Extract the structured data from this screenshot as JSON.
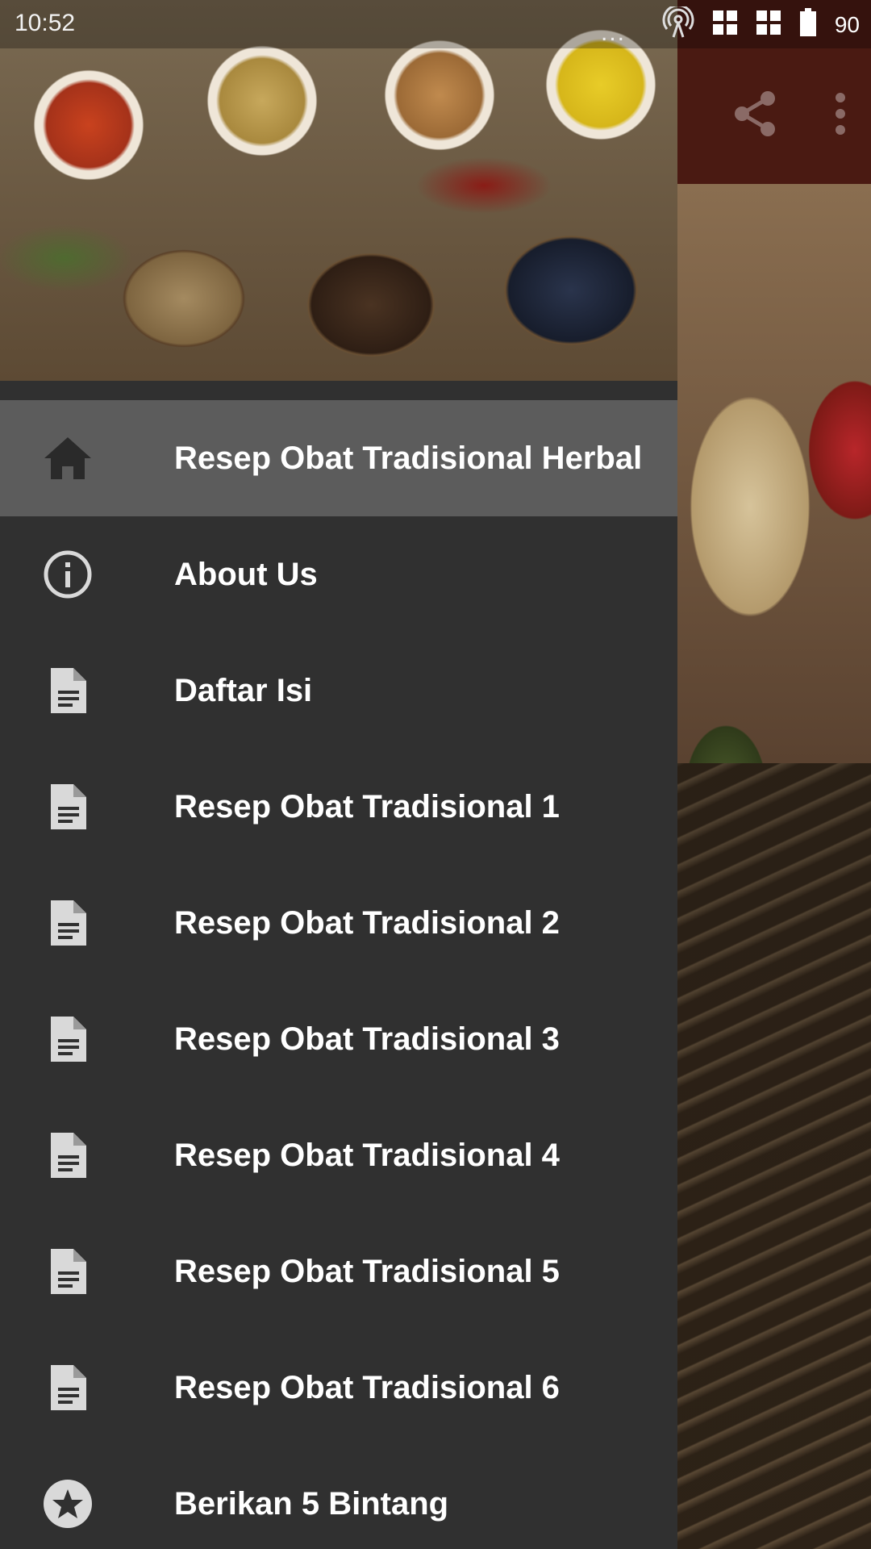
{
  "status_bar": {
    "time": "10:52",
    "overflow_dots": "...",
    "battery_level": "90"
  },
  "drawer": {
    "items": [
      {
        "label": "Resep Obat Tradisional Herbal",
        "icon": "home-icon",
        "active": true
      },
      {
        "label": "About Us",
        "icon": "info-icon",
        "active": false
      },
      {
        "label": "Daftar Isi",
        "icon": "document-icon",
        "active": false
      },
      {
        "label": "Resep Obat Tradisional 1",
        "icon": "document-icon",
        "active": false
      },
      {
        "label": "Resep Obat Tradisional 2",
        "icon": "document-icon",
        "active": false
      },
      {
        "label": "Resep Obat Tradisional 3",
        "icon": "document-icon",
        "active": false
      },
      {
        "label": "Resep Obat Tradisional 4",
        "icon": "document-icon",
        "active": false
      },
      {
        "label": "Resep Obat Tradisional 5",
        "icon": "document-icon",
        "active": false
      },
      {
        "label": "Resep Obat Tradisional 6",
        "icon": "document-icon",
        "active": false
      },
      {
        "label": "Berikan 5 Bintang",
        "icon": "star-icon",
        "active": false
      }
    ]
  },
  "colors": {
    "drawer_bg": "#303030",
    "active_item_bg": "#5c5c5c",
    "toolbar_bg": "#4a1a12",
    "icon_color": "#d9d9d9",
    "text_color": "#ffffff"
  }
}
